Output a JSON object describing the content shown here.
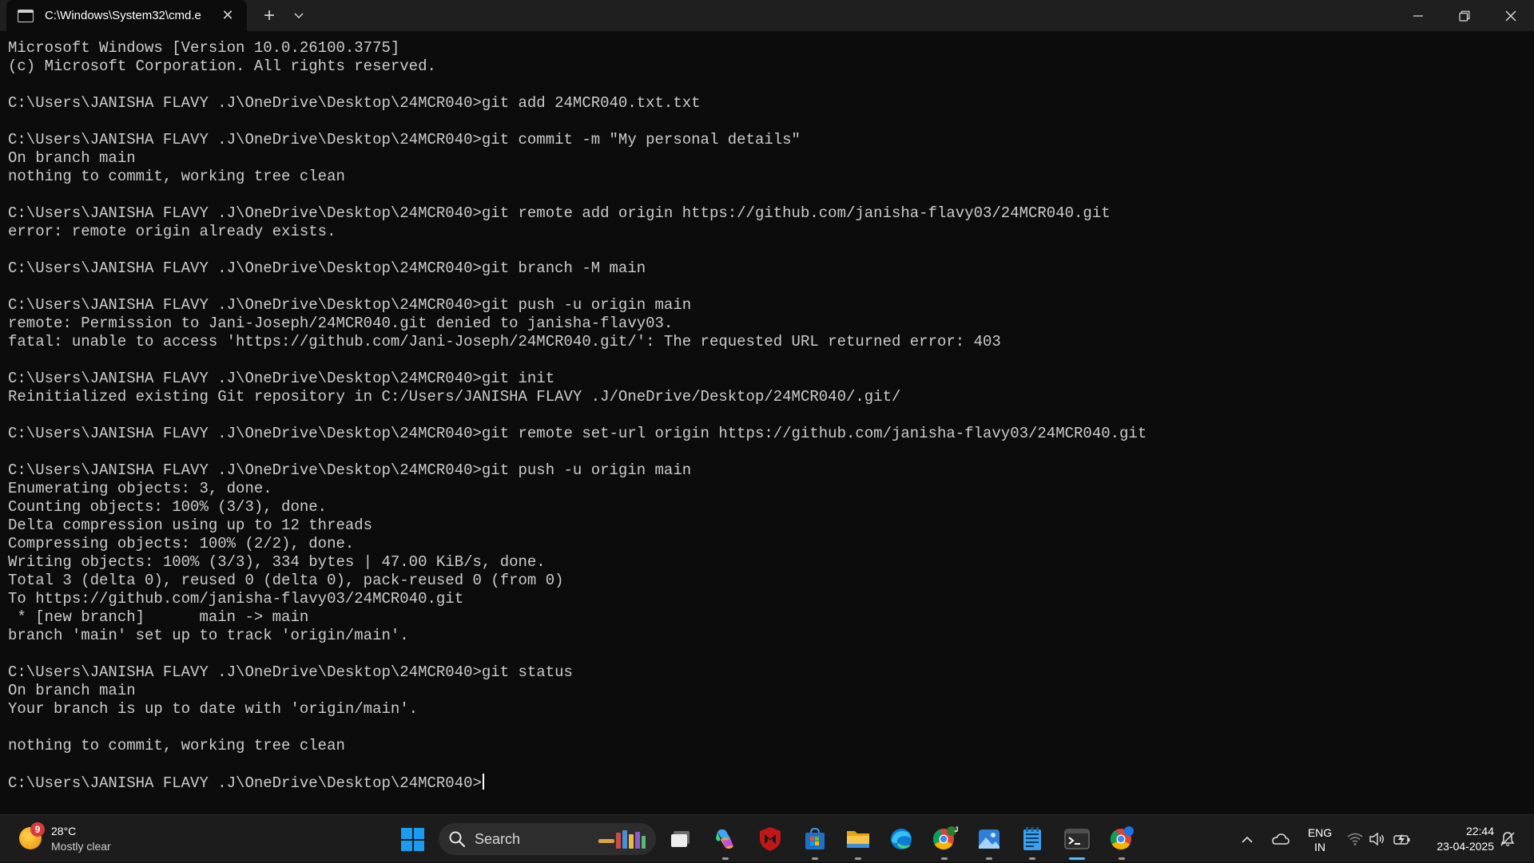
{
  "window": {
    "tab_title": "C:\\Windows\\System32\\cmd.e",
    "tab_icon": "cmd-icon"
  },
  "console": {
    "lines": [
      "Microsoft Windows [Version 10.0.26100.3775]",
      "(c) Microsoft Corporation. All rights reserved.",
      "",
      "C:\\Users\\JANISHA FLAVY .J\\OneDrive\\Desktop\\24MCR040>git add 24MCR040.txt.txt",
      "",
      "C:\\Users\\JANISHA FLAVY .J\\OneDrive\\Desktop\\24MCR040>git commit -m \"My personal details\"",
      "On branch main",
      "nothing to commit, working tree clean",
      "",
      "C:\\Users\\JANISHA FLAVY .J\\OneDrive\\Desktop\\24MCR040>git remote add origin https://github.com/janisha-flavy03/24MCR040.git",
      "error: remote origin already exists.",
      "",
      "C:\\Users\\JANISHA FLAVY .J\\OneDrive\\Desktop\\24MCR040>git branch -M main",
      "",
      "C:\\Users\\JANISHA FLAVY .J\\OneDrive\\Desktop\\24MCR040>git push -u origin main",
      "remote: Permission to Jani-Joseph/24MCR040.git denied to janisha-flavy03.",
      "fatal: unable to access 'https://github.com/Jani-Joseph/24MCR040.git/': The requested URL returned error: 403",
      "",
      "C:\\Users\\JANISHA FLAVY .J\\OneDrive\\Desktop\\24MCR040>git init",
      "Reinitialized existing Git repository in C:/Users/JANISHA FLAVY .J/OneDrive/Desktop/24MCR040/.git/",
      "",
      "C:\\Users\\JANISHA FLAVY .J\\OneDrive\\Desktop\\24MCR040>git remote set-url origin https://github.com/janisha-flavy03/24MCR040.git",
      "",
      "C:\\Users\\JANISHA FLAVY .J\\OneDrive\\Desktop\\24MCR040>git push -u origin main",
      "Enumerating objects: 3, done.",
      "Counting objects: 100% (3/3), done.",
      "Delta compression using up to 12 threads",
      "Compressing objects: 100% (2/2), done.",
      "Writing objects: 100% (3/3), 334 bytes | 47.00 KiB/s, done.",
      "Total 3 (delta 0), reused 0 (delta 0), pack-reused 0 (from 0)",
      "To https://github.com/janisha-flavy03/24MCR040.git",
      " * [new branch]      main -> main",
      "branch 'main' set up to track 'origin/main'.",
      "",
      "C:\\Users\\JANISHA FLAVY .J\\OneDrive\\Desktop\\24MCR040>git status",
      "On branch main",
      "Your branch is up to date with 'origin/main'.",
      "",
      "nothing to commit, working tree clean",
      ""
    ],
    "prompt": "C:\\Users\\JANISHA FLAVY .J\\OneDrive\\Desktop\\24MCR040>"
  },
  "taskbar": {
    "weather": {
      "badge": "9",
      "temperature": "28°C",
      "condition": "Mostly clear"
    },
    "search_label": "Search",
    "apps": [
      "task-view-icon",
      "copilot-icon",
      "mcafee-icon",
      "microsoft-store-icon",
      "file-explorer-icon",
      "edge-icon",
      "chrome-profile-j-icon",
      "photos-icon",
      "notepad-icon",
      "terminal-icon",
      "chrome-icon"
    ],
    "language": {
      "line1": "ENG",
      "line2": "IN"
    },
    "clock": {
      "time": "22:44",
      "date": "23-04-2025"
    },
    "chrome_profile_letter": "J"
  },
  "colors": {
    "console_bg": "#0c0c0c",
    "console_fg": "#cccccc",
    "accent": "#4cc2ff"
  }
}
